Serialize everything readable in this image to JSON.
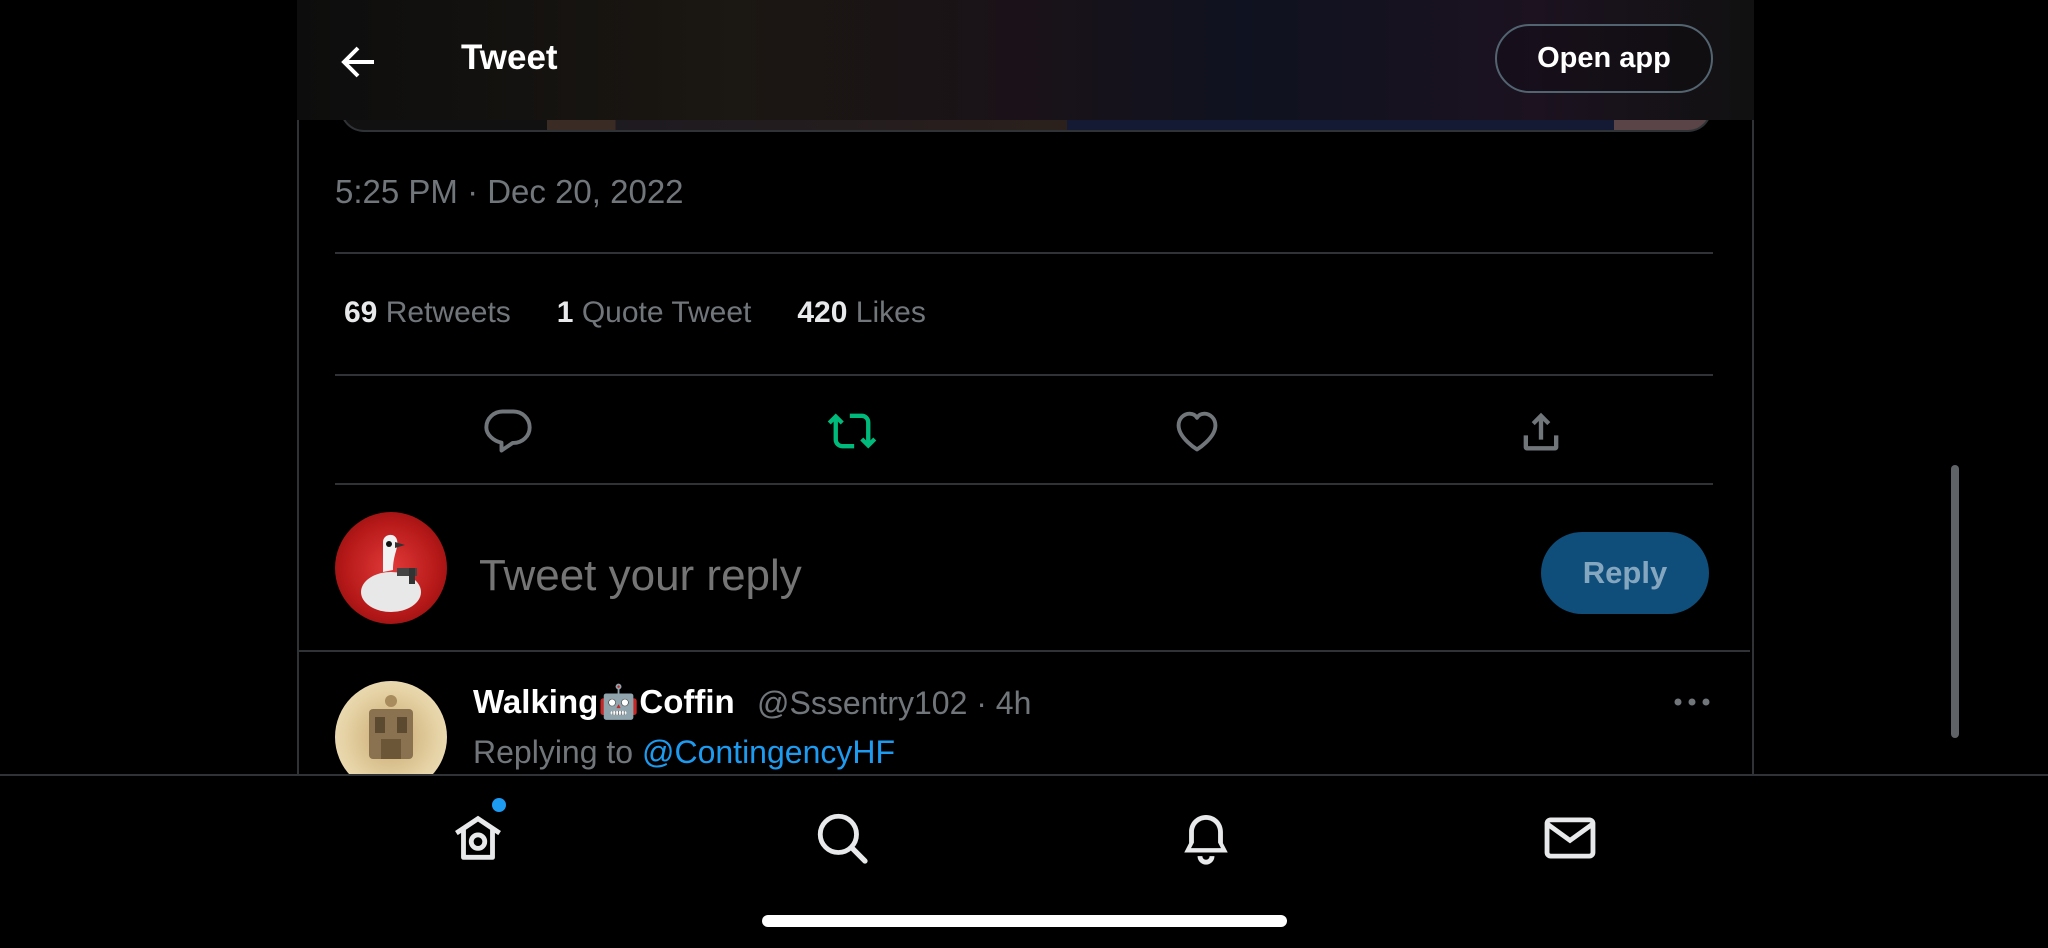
{
  "header": {
    "title": "Tweet",
    "open_app_label": "Open app"
  },
  "tweet": {
    "timestamp": "5:25 PM · Dec 20, 2022",
    "stats": {
      "retweets_count": "69",
      "retweets_label": "Retweets",
      "quotes_count": "1",
      "quotes_label": "Quote Tweet",
      "likes_count": "420",
      "likes_label": "Likes"
    },
    "retweet_active_color": "#00ba7c"
  },
  "composer": {
    "placeholder": "Tweet your reply",
    "reply_button_label": "Reply"
  },
  "reply": {
    "name": "Walking🤖Coffin",
    "handle_time": "@Sssentry102 · 4h",
    "replying_prefix": "Replying to",
    "replying_to": "@ContingencyHF"
  },
  "bottom_nav": {
    "items": [
      "home-icon",
      "search-icon",
      "bell-icon",
      "mail-icon"
    ],
    "home_has_notification": true
  }
}
